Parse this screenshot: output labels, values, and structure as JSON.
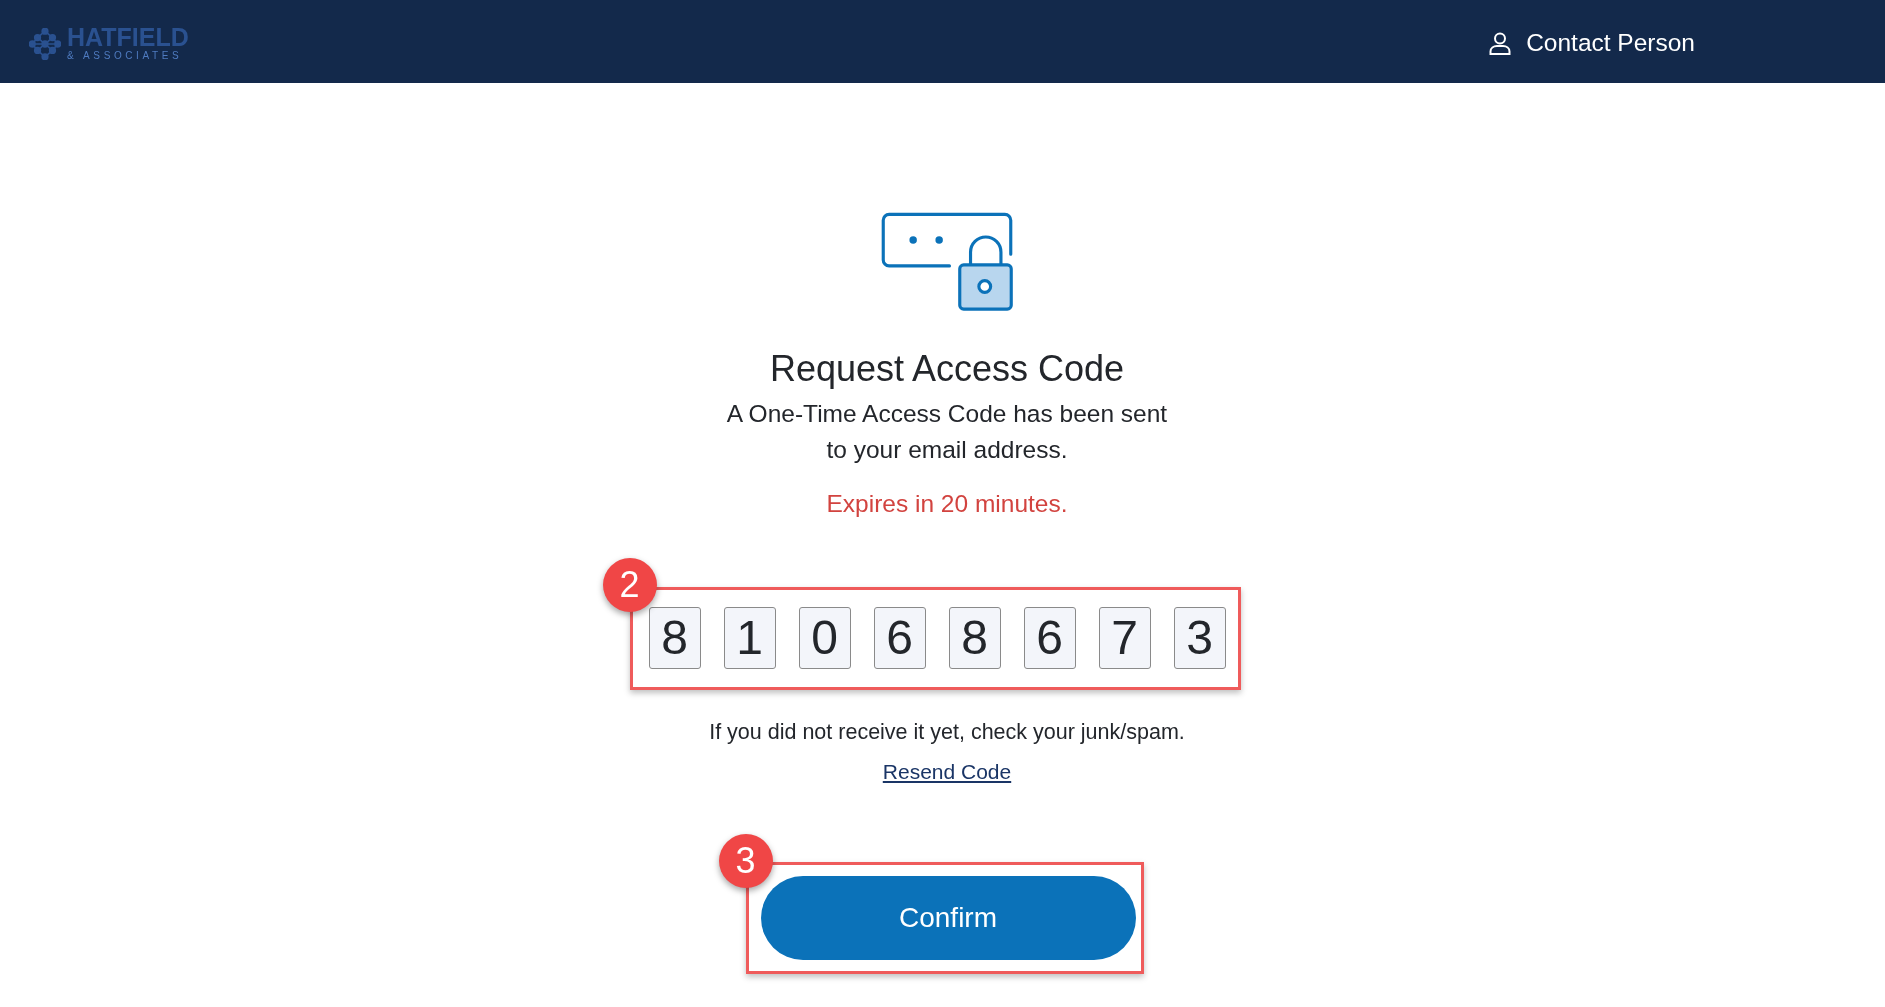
{
  "header": {
    "logo": {
      "name": "HATFIELD",
      "tagline": "& ASSOCIATES"
    },
    "user_menu": {
      "label": "Contact Person"
    }
  },
  "content": {
    "title": "Request Access Code",
    "message": "A One-Time Access Code has been sent to your email address.",
    "expiry_notice": "Expires in 20 minutes.",
    "code_entry": {
      "step": "2",
      "digits": [
        {
          "value": "8"
        },
        {
          "value": "1"
        },
        {
          "value": "0"
        },
        {
          "value": "6"
        },
        {
          "value": "8"
        },
        {
          "value": "6"
        },
        {
          "value": "7"
        },
        {
          "value": "3"
        }
      ]
    },
    "help_text": "If you did not receive it yet, check your junk/spam.",
    "resend_link": "Resend Code",
    "confirm_button": {
      "label": "Confirm",
      "step": "3"
    }
  }
}
